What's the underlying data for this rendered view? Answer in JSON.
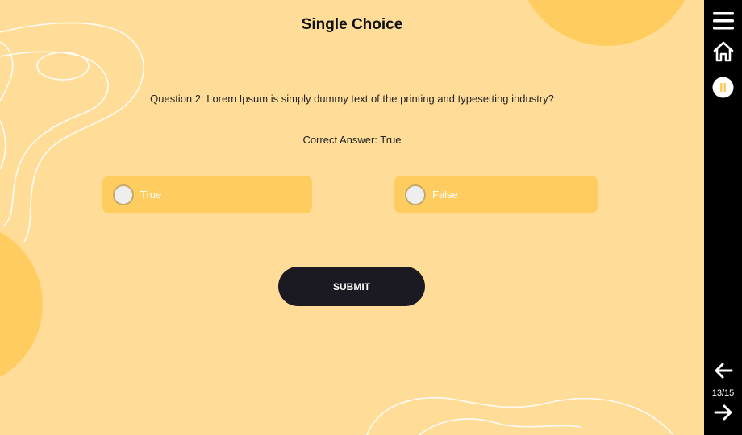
{
  "page": {
    "title": "Single Choice",
    "question": "Question 2: Lorem Ipsum is simply dummy text of the printing and typesetting industry?",
    "correct_answer": "Correct Answer: True"
  },
  "options": [
    {
      "label": "True"
    },
    {
      "label": "False"
    }
  ],
  "submit_label": "SUBMIT",
  "sidebar": {
    "icons": [
      "menu-icon",
      "home-icon",
      "pause-icon",
      "arrow-left-icon",
      "arrow-right-icon"
    ],
    "counter": "13/15"
  },
  "colors": {
    "background": "#FFDD99",
    "accent": "#FFCC5F",
    "button": "#1B1A23",
    "sidebar": "#000000"
  }
}
